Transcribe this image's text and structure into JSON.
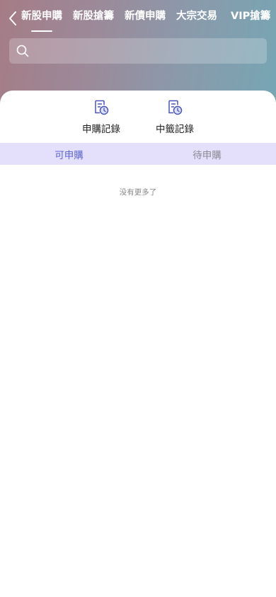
{
  "header": {
    "back_icon": "chevron-left-icon",
    "tabs": [
      {
        "label": "新股申購",
        "active": true
      },
      {
        "label": "新股搶籌",
        "active": false
      },
      {
        "label": "新債申購",
        "active": false
      },
      {
        "label": "大宗交易",
        "active": false
      },
      {
        "label": "VIP搶籌",
        "active": false
      }
    ],
    "search": {
      "placeholder": "",
      "value": "",
      "icon": "search-icon"
    }
  },
  "quick_actions": [
    {
      "label": "申購記錄",
      "icon": "record-clock-icon"
    },
    {
      "label": "中籤記錄",
      "icon": "record-clock-icon"
    }
  ],
  "segments": [
    {
      "label": "可申購",
      "active": true
    },
    {
      "label": "待申購",
      "active": false
    }
  ],
  "list": {
    "empty_text": "没有更多了"
  },
  "colors": {
    "header_gradient_start": "#a57c86",
    "header_gradient_end": "#76a6b4",
    "accent": "#5d67d0",
    "segment_bg": "#e4e0fb"
  }
}
